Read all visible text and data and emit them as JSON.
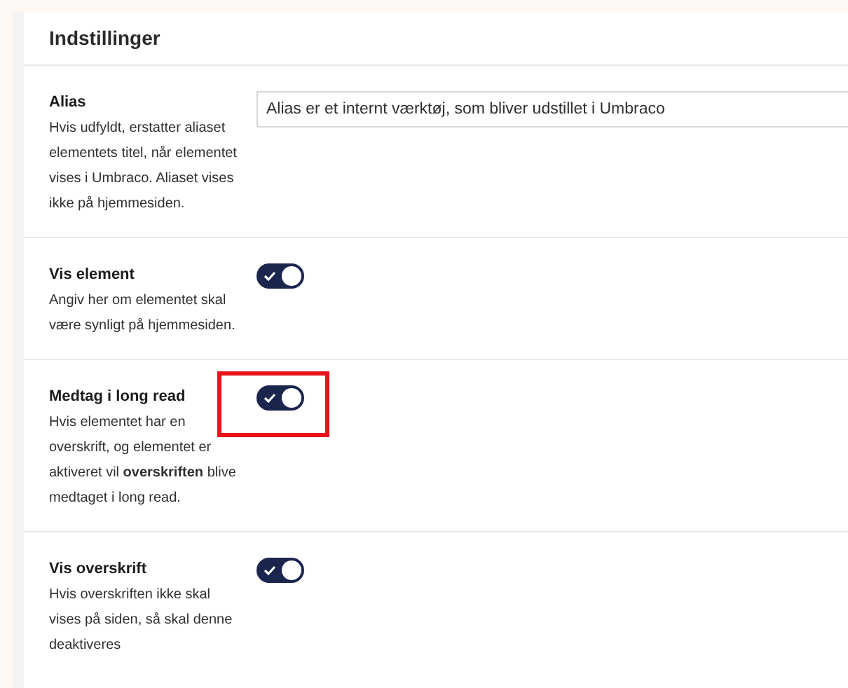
{
  "panel": {
    "title": "Indstillinger"
  },
  "rows": [
    {
      "kind": "text",
      "label": "Alias",
      "description": "Hvis udfyldt, erstatter aliaset elementets titel, når elementet vises i Umbraco. Aliaset vises ikke på hjemmesiden.",
      "value": "Alias er et internt værktøj, som bliver udstillet i Umbraco"
    },
    {
      "kind": "toggle",
      "label": "Vis element",
      "description": "Angiv her om elementet skal være synligt på hjemmesiden.",
      "on": true,
      "highlighted": false
    },
    {
      "kind": "toggle",
      "label": "Medtag i long read",
      "description": "Hvis elementet har en overskrift, og elementet er aktiveret vil **overskriften** blive medtaget i long read.",
      "on": true,
      "highlighted": true
    },
    {
      "kind": "toggle",
      "label": "Vis overskrift",
      "description": "Hvis overskriften ikke skal vises på siden, så skal denne deaktiveres",
      "on": true,
      "highlighted": false
    }
  ]
}
